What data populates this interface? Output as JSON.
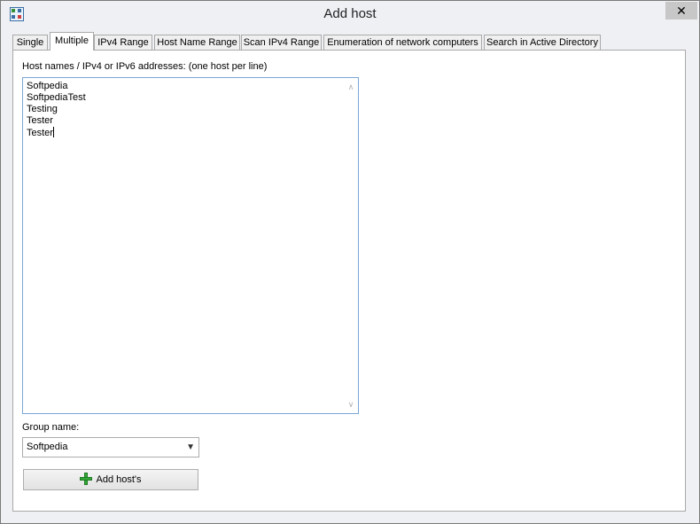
{
  "window": {
    "title": "Add host",
    "close_glyph": "✕",
    "app_icon": "network-grid-icon"
  },
  "tabs": [
    {
      "label": "Single",
      "active": false
    },
    {
      "label": "Multiple",
      "active": true
    },
    {
      "label": "IPv4 Range",
      "active": false
    },
    {
      "label": "Host Name Range",
      "active": false
    },
    {
      "label": "Scan IPv4 Range",
      "active": false
    },
    {
      "label": "Enumeration of network computers",
      "active": false
    },
    {
      "label": "Search in Active Directory",
      "active": false
    }
  ],
  "hosts": {
    "label": "Host names / IPv4 or IPv6 addresses: (one host per line)",
    "lines": [
      "Softpedia",
      "SoftpediaTest",
      "Testing",
      "Tester",
      "Tester"
    ]
  },
  "group": {
    "label": "Group name:",
    "value": "Softpedia"
  },
  "add_button": {
    "label": "Add host's",
    "icon": "plus-icon"
  },
  "colors": {
    "accent_border": "#7aa7d6",
    "plus_green": "#35a83a"
  }
}
